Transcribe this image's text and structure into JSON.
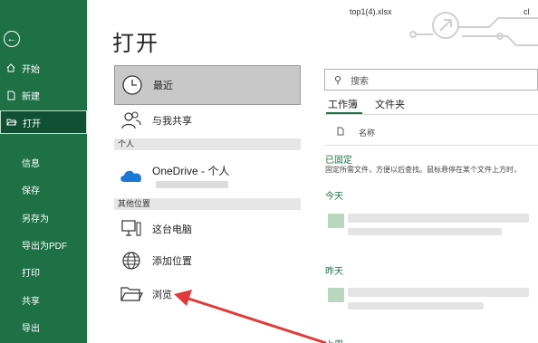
{
  "nav": {
    "back_icon": "back-arrow-icon",
    "items": [
      {
        "label": "开始",
        "icon": "home-icon"
      },
      {
        "label": "新建",
        "icon": "new-doc-icon"
      },
      {
        "label": "打开",
        "icon": "folder-open-icon",
        "active": true
      },
      {
        "label": "信息"
      },
      {
        "label": "保存"
      },
      {
        "label": "另存为"
      },
      {
        "label": "导出为PDF"
      },
      {
        "label": "打印"
      },
      {
        "label": "共享"
      },
      {
        "label": "导出"
      }
    ]
  },
  "page_title": "打开",
  "locations": {
    "recent": "最近",
    "shared": "与我共享",
    "personal_section": "个人",
    "onedrive": "OneDrive - 个人",
    "other_section": "其他位置",
    "this_pc": "这台电脑",
    "add_place": "添加位置",
    "browse": "浏览"
  },
  "header": {
    "doc_name": "top1(4).xlsx",
    "user_initial": "cl"
  },
  "search": {
    "placeholder": "搜索"
  },
  "tabs": [
    "工作簿",
    "文件夹"
  ],
  "list": {
    "column_name": "名称",
    "pinned_heading": "已固定",
    "pinned_desc": "固定所需文件，方便以后查找。鼠标悬停在某个文件上方时，",
    "today": "今天",
    "yesterday": "昨天",
    "last_week": "上周"
  },
  "colors": {
    "nav_bg": "#1e7145",
    "accent": "#1e7145",
    "annotation_arrow": "#e03a3a"
  }
}
